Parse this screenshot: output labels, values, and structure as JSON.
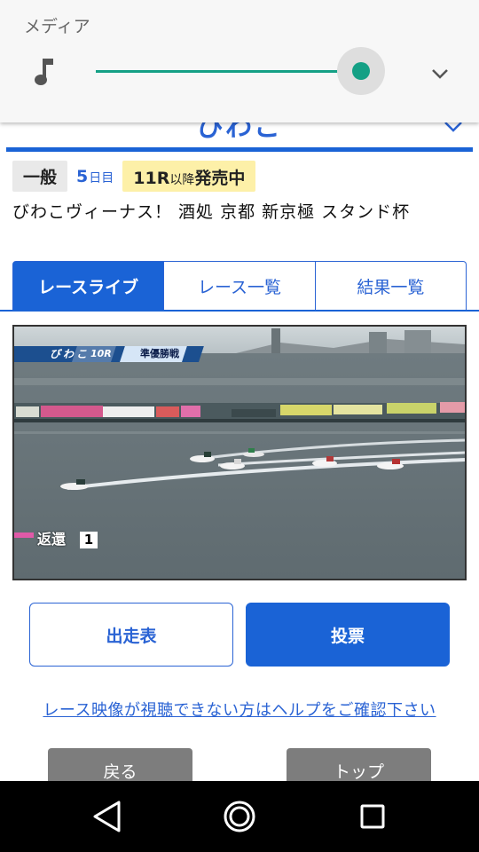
{
  "media": {
    "title": "メディア",
    "icon": "music-note-icon",
    "volume_fraction": 0.92,
    "accent_color": "#14a085"
  },
  "header": {
    "venue": "びわこ"
  },
  "info": {
    "grade": "一般",
    "day_number": "5",
    "day_suffix": "日目",
    "sale_race": "11R",
    "sale_after": "以降",
    "sale_status": "発売中"
  },
  "race_name": "びわこヴィーナス！ 酒処 京都 新京極 スタンド杯",
  "tabs": [
    {
      "label": "レースライブ",
      "active": true
    },
    {
      "label": "レース一覧",
      "active": false
    },
    {
      "label": "結果一覧",
      "active": false
    }
  ],
  "video": {
    "venue_label": "びわこ",
    "race_label": "10R",
    "stage_label": "準優勝戦",
    "return_label": "返還",
    "return_number": "1"
  },
  "buttons": {
    "entries": "出走表",
    "vote": "投票"
  },
  "help_link": "レース映像が視聴できない方はヘルプをご確認下さい",
  "nav": {
    "back": "戻る",
    "top": "トップ"
  },
  "colors": {
    "primary": "#1a63d6",
    "link": "#2a63d4",
    "sale_badge": "#fdf0a8"
  }
}
